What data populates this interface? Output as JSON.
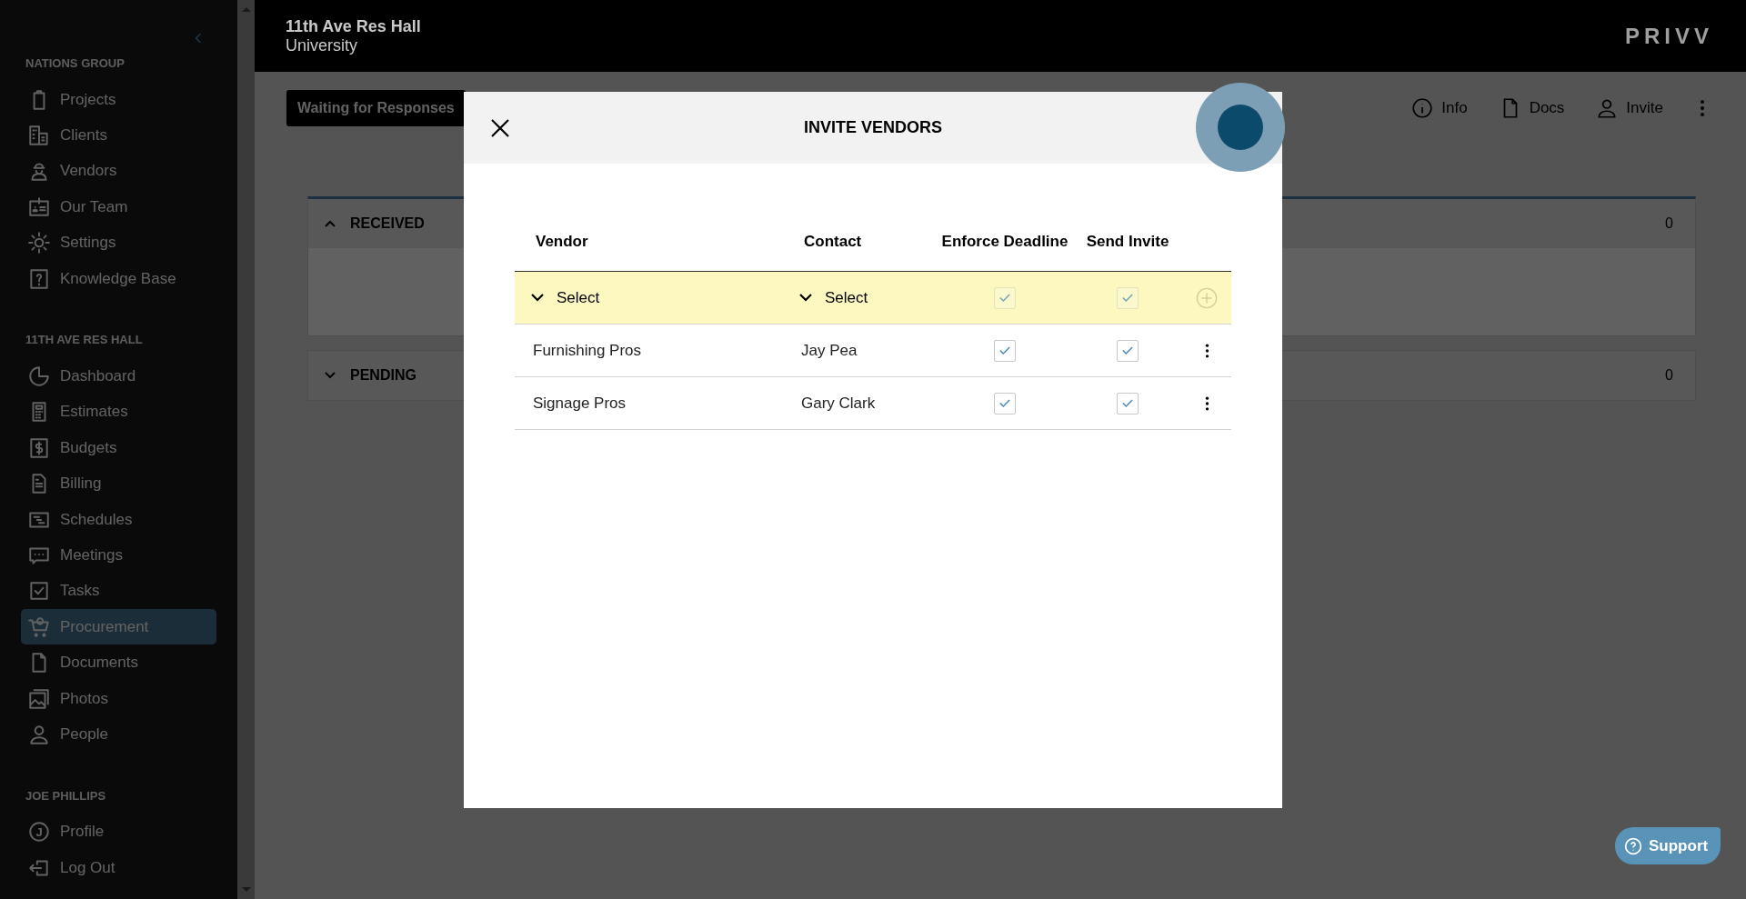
{
  "header": {
    "title": "11th Ave Res Hall",
    "subtitle": "University",
    "logo": "PRIVV"
  },
  "sidebar": {
    "groups": [
      {
        "heading": "NATIONS GROUP",
        "items": [
          {
            "label": "Projects",
            "selected": false
          },
          {
            "label": "Clients",
            "selected": false
          },
          {
            "label": "Vendors",
            "selected": false
          },
          {
            "label": "Our Team",
            "selected": false
          },
          {
            "label": "Settings",
            "selected": false
          },
          {
            "label": "Knowledge Base",
            "selected": false
          }
        ]
      },
      {
        "heading": "11TH AVE RES HALL",
        "items": [
          {
            "label": "Dashboard",
            "selected": false
          },
          {
            "label": "Estimates",
            "selected": false
          },
          {
            "label": "Budgets",
            "selected": false
          },
          {
            "label": "Billing",
            "selected": false
          },
          {
            "label": "Schedules",
            "selected": false
          },
          {
            "label": "Meetings",
            "selected": false
          },
          {
            "label": "Tasks",
            "selected": false
          },
          {
            "label": "Procurement",
            "selected": true
          },
          {
            "label": "Documents",
            "selected": false
          },
          {
            "label": "Photos",
            "selected": false
          },
          {
            "label": "People",
            "selected": false
          }
        ]
      },
      {
        "heading": "JOE PHILLIPS",
        "items": [
          {
            "label": "Profile",
            "selected": false,
            "initial": "J"
          },
          {
            "label": "Log Out",
            "selected": false
          }
        ]
      }
    ]
  },
  "toolbar": {
    "status_button": "Waiting for Responses",
    "actions": [
      {
        "label": "Info"
      },
      {
        "label": "Docs"
      },
      {
        "label": "Invite"
      }
    ]
  },
  "sections": [
    {
      "title": "RECEIVED",
      "count": "0",
      "expanded": true
    },
    {
      "title": "PENDING",
      "count": "0",
      "expanded": false
    }
  ],
  "modal": {
    "title": "INVITE VENDORS",
    "columns": [
      "Vendor",
      "Contact",
      "Enforce Deadline",
      "Send Invite"
    ],
    "new_row": {
      "vendor_select": "Select",
      "contact_select": "Select",
      "enforce_deadline": true,
      "send_invite": true
    },
    "rows": [
      {
        "vendor": "Furnishing Pros",
        "contact": "Jay Pea",
        "enforce_deadline": true,
        "send_invite": true
      },
      {
        "vendor": "Signage Pros",
        "contact": "Gary Clark",
        "enforce_deadline": true,
        "send_invite": true
      }
    ]
  },
  "support": {
    "label": "Support"
  }
}
